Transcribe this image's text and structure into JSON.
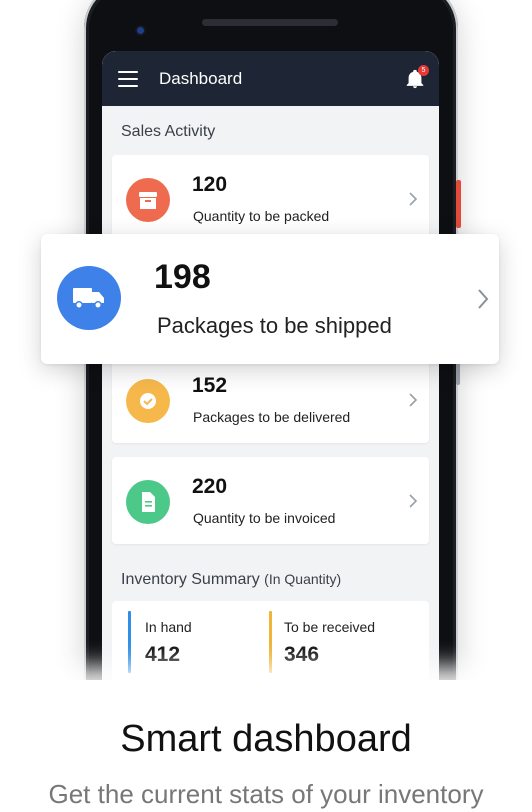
{
  "appbar": {
    "title": "Dashboard",
    "notification_count": "5"
  },
  "sales_activity": {
    "title": "Sales Activity",
    "cards": [
      {
        "value": "120",
        "label": "Quantity to be packed",
        "icon": "package-box-icon",
        "color": "#ef6b4f"
      },
      {
        "value": "198",
        "label": "Packages to be shipped",
        "icon": "truck-icon",
        "color": "#3e82e9"
      },
      {
        "value": "152",
        "label": "Packages to be delivered",
        "icon": "check-circle-icon",
        "color": "#f6b84b"
      },
      {
        "value": "220",
        "label": "Quantity to be invoiced",
        "icon": "document-icon",
        "color": "#4cc989"
      }
    ]
  },
  "inventory": {
    "title": "Inventory Summary",
    "subtitle": "(In Quantity)",
    "in_hand": {
      "label": "In hand",
      "value": "412",
      "color": "#2f8fe6"
    },
    "to_be_received": {
      "label": "To be received",
      "value": "346",
      "color": "#f0b437"
    }
  },
  "marketing": {
    "headline": "Smart dashboard",
    "subline": "Get the current stats of your inventory"
  }
}
